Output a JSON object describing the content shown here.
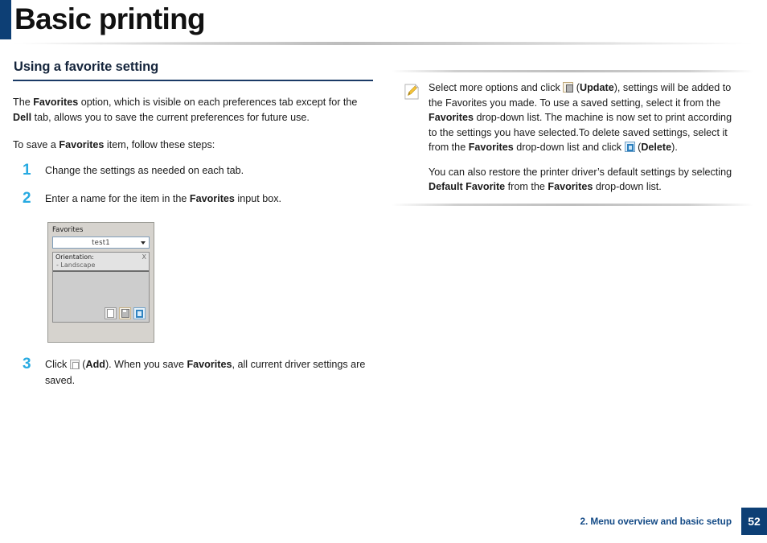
{
  "header": {
    "title": "Basic printing",
    "accent_color": "#0d3f75"
  },
  "left_column": {
    "section_heading": "Using a favorite setting",
    "paragraph_1_prefix": "The ",
    "paragraph_1_bold_1": "Favorites",
    "paragraph_1_mid": " option, which is visible on each preferences tab except for the ",
    "paragraph_1_bold_2": "Dell",
    "paragraph_1_suffix": " tab, allows you to save the current preferences for future use.",
    "paragraph_2_prefix": "To save a ",
    "paragraph_2_bold": "Favorites",
    "paragraph_2_suffix": " item, follow these steps:",
    "steps": [
      {
        "number": "1",
        "text": "Change the settings as needed on each tab."
      },
      {
        "number": "2",
        "text_prefix": "Enter a name for the item in the ",
        "text_bold": "Favorites",
        "text_suffix": " input box."
      },
      {
        "number": "3",
        "text_prefix": "Click ",
        "icon": "add-icon",
        "text_mid_1": " (",
        "text_bold_1": "Add",
        "text_mid_2": "). When you save ",
        "text_bold_2": "Favorites",
        "text_suffix": ", all current driver settings are saved."
      }
    ]
  },
  "dialog_screenshot": {
    "group_label": "Favorites",
    "combo_value": "test1",
    "combo_arrow_icon": "chevron-down-icon",
    "list_header": "Orientation:",
    "list_header_close": "X",
    "list_item": "- Landscape",
    "buttons": [
      {
        "name": "add-button",
        "icon": "page-icon"
      },
      {
        "name": "update-button",
        "icon": "floppy-disk-icon"
      },
      {
        "name": "delete-button",
        "icon": "trash-icon"
      }
    ]
  },
  "note_box": {
    "icon": "note-pencil-icon",
    "paragraph_1_a": "Select more options and click ",
    "paragraph_1_icon": "update-icon",
    "paragraph_1_b": " (",
    "paragraph_1_bold_1": "Update",
    "paragraph_1_c": "), settings will be added to the Favorites you made. To use a saved setting, select it from the ",
    "paragraph_1_bold_2": "Favorites",
    "paragraph_1_d": " drop-down list. The machine is now set to print according to the settings you have selected.To delete saved settings, select it from the ",
    "paragraph_1_bold_3": "Favorites",
    "paragraph_1_e": " drop-down list and click ",
    "paragraph_1_icon_2": "delete-icon",
    "paragraph_1_f": " (",
    "paragraph_1_bold_4": "Delete",
    "paragraph_1_g": ").",
    "paragraph_2_a": "You can also restore the printer driver’s default settings by selecting ",
    "paragraph_2_bold_1": "Default Favorite",
    "paragraph_2_b": " from the ",
    "paragraph_2_bold_2": "Favorites",
    "paragraph_2_c": " drop-down list."
  },
  "footer": {
    "label": "2. Menu overview and basic setup",
    "page_number": "52",
    "page_box_color": "#0d3f75",
    "label_color": "#134a86"
  }
}
